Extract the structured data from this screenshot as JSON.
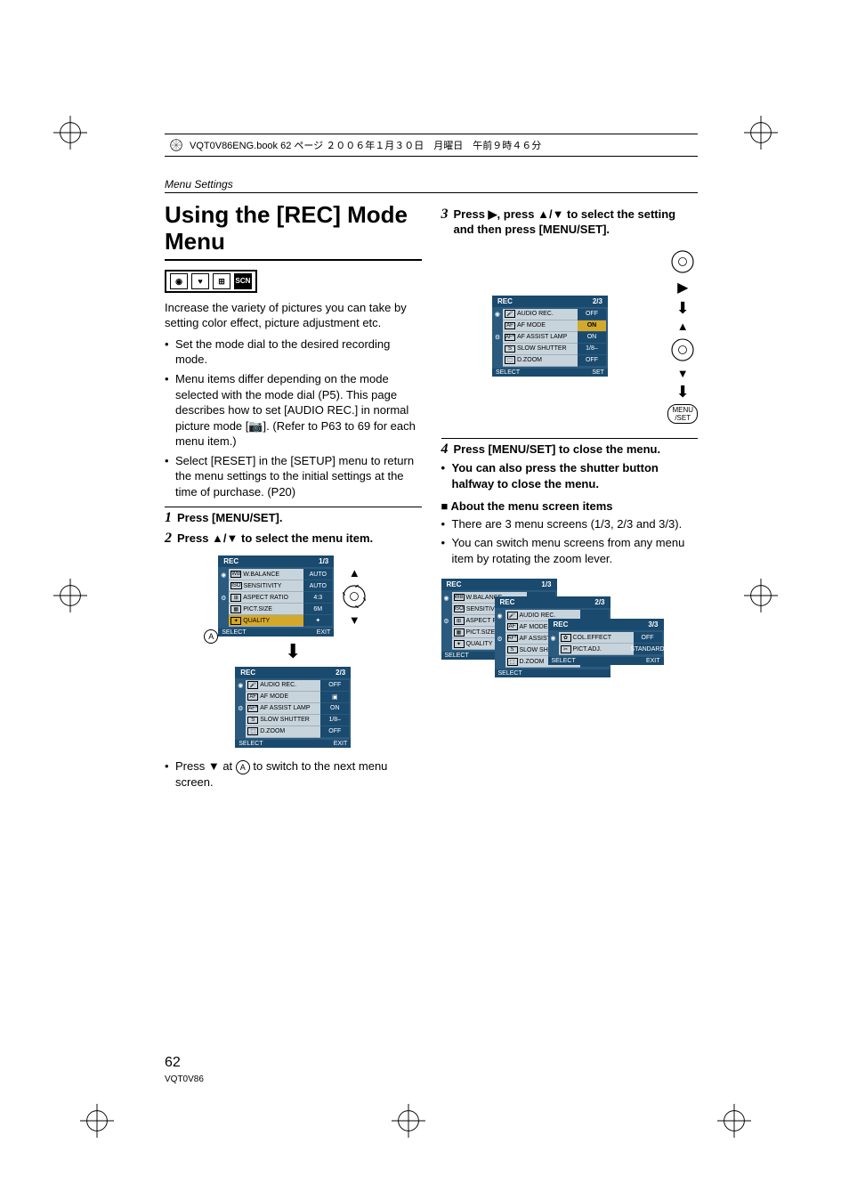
{
  "printHeader": "VQT0V86ENG.book  62 ページ  ２００６年１月３０日　月曜日　午前９時４６分",
  "sectionLabel": "Menu Settings",
  "title": "Using the [REC] Mode Menu",
  "intro": "Increase the variety of pictures you can take by setting color effect, picture adjustment etc.",
  "bullets_left": [
    "Set the mode dial to the desired recording mode.",
    "Menu items differ depending on the mode selected with the mode dial (P5). This page describes how to set [AUDIO REC.] in normal picture mode [📷]. (Refer to P63 to 69 for each menu item.)",
    "Select [RESET] in the [SETUP] menu to return the menu settings to the initial settings at the time of purchase. (P20)"
  ],
  "step1": "Press [MENU/SET].",
  "step2_pre": "Press ",
  "step2_post": " to select the menu item.",
  "step2_note_pre": "Press ▼ at ",
  "step2_note_post": " to switch to the next menu screen.",
  "step3_pre": "Press ▶, press ",
  "step3_post": " to select the setting and then press [MENU/SET].",
  "step4": "Press [MENU/SET] to close the menu.",
  "step4_bullet": "You can also press the shutter button halfway to close the menu.",
  "about_head": "About the menu screen items",
  "about_bullets": [
    "There are 3 menu screens (1/3, 2/3 and 3/3).",
    "You can switch menu screens from any menu item by rotating the zoom lever."
  ],
  "menuSetLabel": "MENU\n/SET",
  "rec_label": "REC",
  "select_label": "SELECT",
  "exit_label": "EXIT",
  "set_label": "SET",
  "menu1": {
    "page": "1/3",
    "rows": [
      {
        "icon": "WB",
        "label": "W.BALANCE",
        "value": "AUTO"
      },
      {
        "icon": "ISO",
        "label": "SENSITIVITY",
        "value": "AUTO"
      },
      {
        "icon": "⊞",
        "label": "ASPECT RATIO",
        "value": "4:3"
      },
      {
        "icon": "▦",
        "label": "PICT.SIZE",
        "value": "6M"
      },
      {
        "icon": "✦",
        "label": "QUALITY",
        "value": "✦"
      }
    ]
  },
  "menu2": {
    "page": "2/3",
    "rows": [
      {
        "icon": "🎤",
        "label": "AUDIO REC.",
        "value": "OFF"
      },
      {
        "icon": "AF",
        "label": "AF MODE",
        "value": "▣"
      },
      {
        "icon": "AF*",
        "label": "AF ASSIST LAMP",
        "value": "ON"
      },
      {
        "icon": "S",
        "label": "SLOW SHUTTER",
        "value": "1/8–"
      },
      {
        "icon": "⬚",
        "label": "D.ZOOM",
        "value": "OFF"
      }
    ]
  },
  "menu3_step3": {
    "page": "2/3",
    "rows": [
      {
        "icon": "🎤",
        "label": "AUDIO REC.",
        "value": "OFF"
      },
      {
        "icon": "AF",
        "label": "AF MODE",
        "value": "ON",
        "hl": true
      },
      {
        "icon": "AF*",
        "label": "AF ASSIST LAMP",
        "value": "ON"
      },
      {
        "icon": "S",
        "label": "SLOW SHUTTER",
        "value": "1/8–"
      },
      {
        "icon": "⬚",
        "label": "D.ZOOM",
        "value": "OFF"
      }
    ]
  },
  "menu_c3": {
    "page": "3/3",
    "rows": [
      {
        "icon": "✿",
        "label": "COL.EFFECT",
        "value": "OFF"
      },
      {
        "icon": "✂",
        "label": "PICT.ADJ.",
        "value": "STANDARD"
      }
    ]
  },
  "circled_A": "A",
  "pageNumber": "62",
  "docCode": "VQT0V86"
}
